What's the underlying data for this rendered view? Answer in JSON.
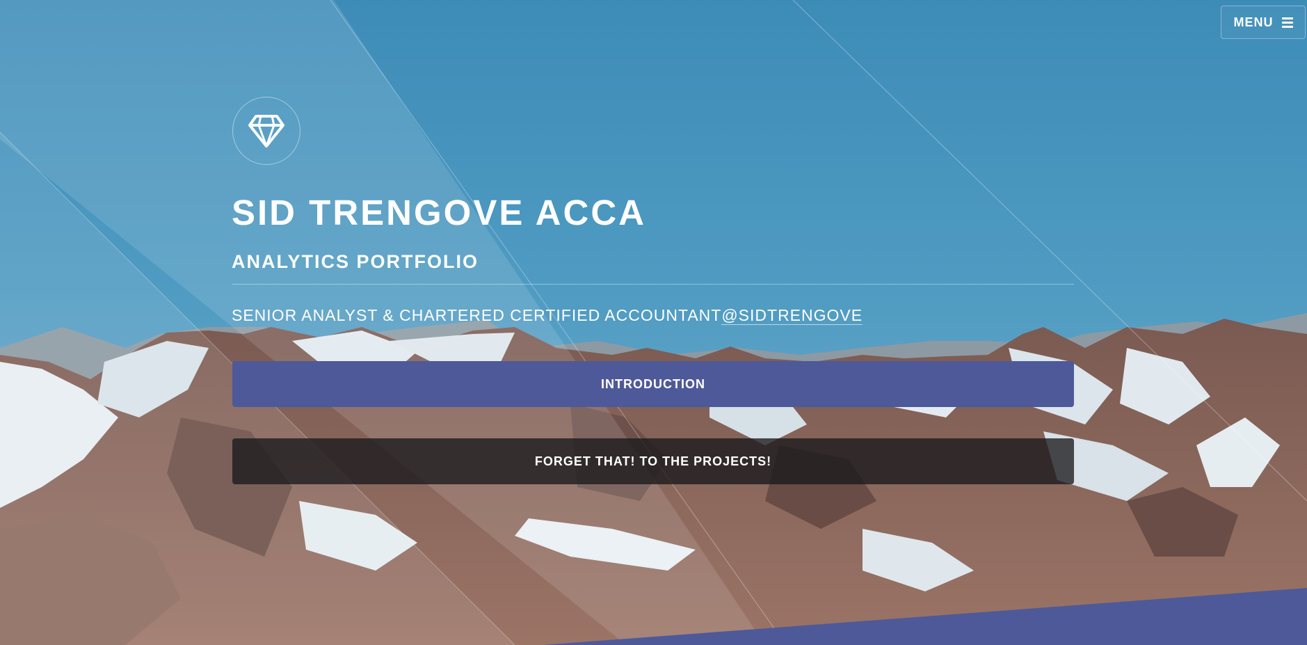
{
  "header": {
    "menu_label": "MENU",
    "menu_icon": "hamburger-icon"
  },
  "hero": {
    "logo_icon": "diamond-icon",
    "title": "SID TRENGOVE ACCA",
    "subtitle": "ANALYTICS PORTFOLIO",
    "tagline_prefix": "SENIOR ANALYST & CHARTERED CERTIFIED ACCOUNTANT",
    "tagline_handle": "@SIDTRENGOVE"
  },
  "actions": {
    "primary_label": "INTRODUCTION",
    "secondary_label": "FORGET THAT! TO THE PROJECTS!"
  },
  "colors": {
    "sky": "#3f8fba",
    "accent": "#4e5999",
    "dark_button": "#19191c"
  }
}
